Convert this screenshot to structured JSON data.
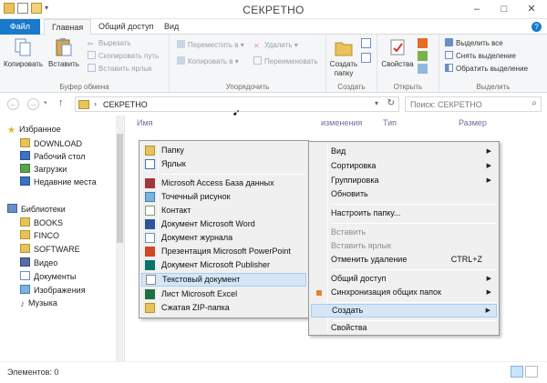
{
  "window": {
    "title": "СЕКРЕТНО",
    "minimize": "–",
    "maximize": "□",
    "close": "✕"
  },
  "tabs": {
    "file": "Файл",
    "home": "Главная",
    "share": "Общий доступ",
    "view": "Вид"
  },
  "ribbon": {
    "clipboard": {
      "label": "Буфер обмена",
      "copy": "Копировать",
      "paste": "Вставить",
      "cut": "Вырезать",
      "copy_path": "Скопировать путь",
      "paste_shortcut": "Вставить ярлык"
    },
    "organize": {
      "label": "Упорядочить",
      "move_to": "Переместить в",
      "copy_to": "Копировать в",
      "delete": "Удалить",
      "rename": "Переименовать"
    },
    "new": {
      "label": "Создать",
      "new_folder": "Создать папку"
    },
    "open": {
      "label": "Открыть",
      "properties": "Свойства"
    },
    "select": {
      "label": "Выделить",
      "select_all": "Выделить все",
      "select_none": "Снять выделение",
      "invert": "Обратить выделение"
    }
  },
  "address": {
    "path": "СЕКРЕТНО",
    "search_placeholder": "Поиск: СЕКРЕТНО"
  },
  "nav": {
    "favorites": "Избранное",
    "download": "DOWNLOAD",
    "desktop": "Рабочий стол",
    "downloads": "Загрузки",
    "recent": "Недавние места",
    "libraries": "Библиотеки",
    "books": "BOOKS",
    "finco": "FINCO",
    "software": "SOFTWARE",
    "video": "Видео",
    "documents": "Документы",
    "images": "Изображения",
    "music": "Музыка"
  },
  "columns": {
    "name": "Имя",
    "modified": "изменения",
    "type": "Тип",
    "size": "Размер"
  },
  "status": {
    "items": "Элементов: 0"
  },
  "context_menu": {
    "view": "Вид",
    "sort": "Сортировка",
    "group": "Группировка",
    "refresh": "Обновить",
    "customize": "Настроить папку...",
    "paste": "Вставить",
    "paste_shortcut": "Вставить ярлык",
    "undo_delete": "Отменить удаление",
    "undo_shortcut": "CTRL+Z",
    "share": "Общий доступ",
    "sync": "Синхронизация общих папок",
    "create": "Создать",
    "properties": "Свойства"
  },
  "submenu": {
    "folder": "Папку",
    "shortcut": "Ярлык",
    "access": "Microsoft Access База данных",
    "bitmap": "Точечный рисунок",
    "contact": "Контакт",
    "word": "Документ Microsoft Word",
    "journal": "Документ журнала",
    "powerpoint": "Презентация Microsoft PowerPoint",
    "publisher": "Документ Microsoft Publisher",
    "text": "Текстовый документ",
    "excel": "Лист Microsoft Excel",
    "zip": "Сжатая ZIP-папка"
  }
}
